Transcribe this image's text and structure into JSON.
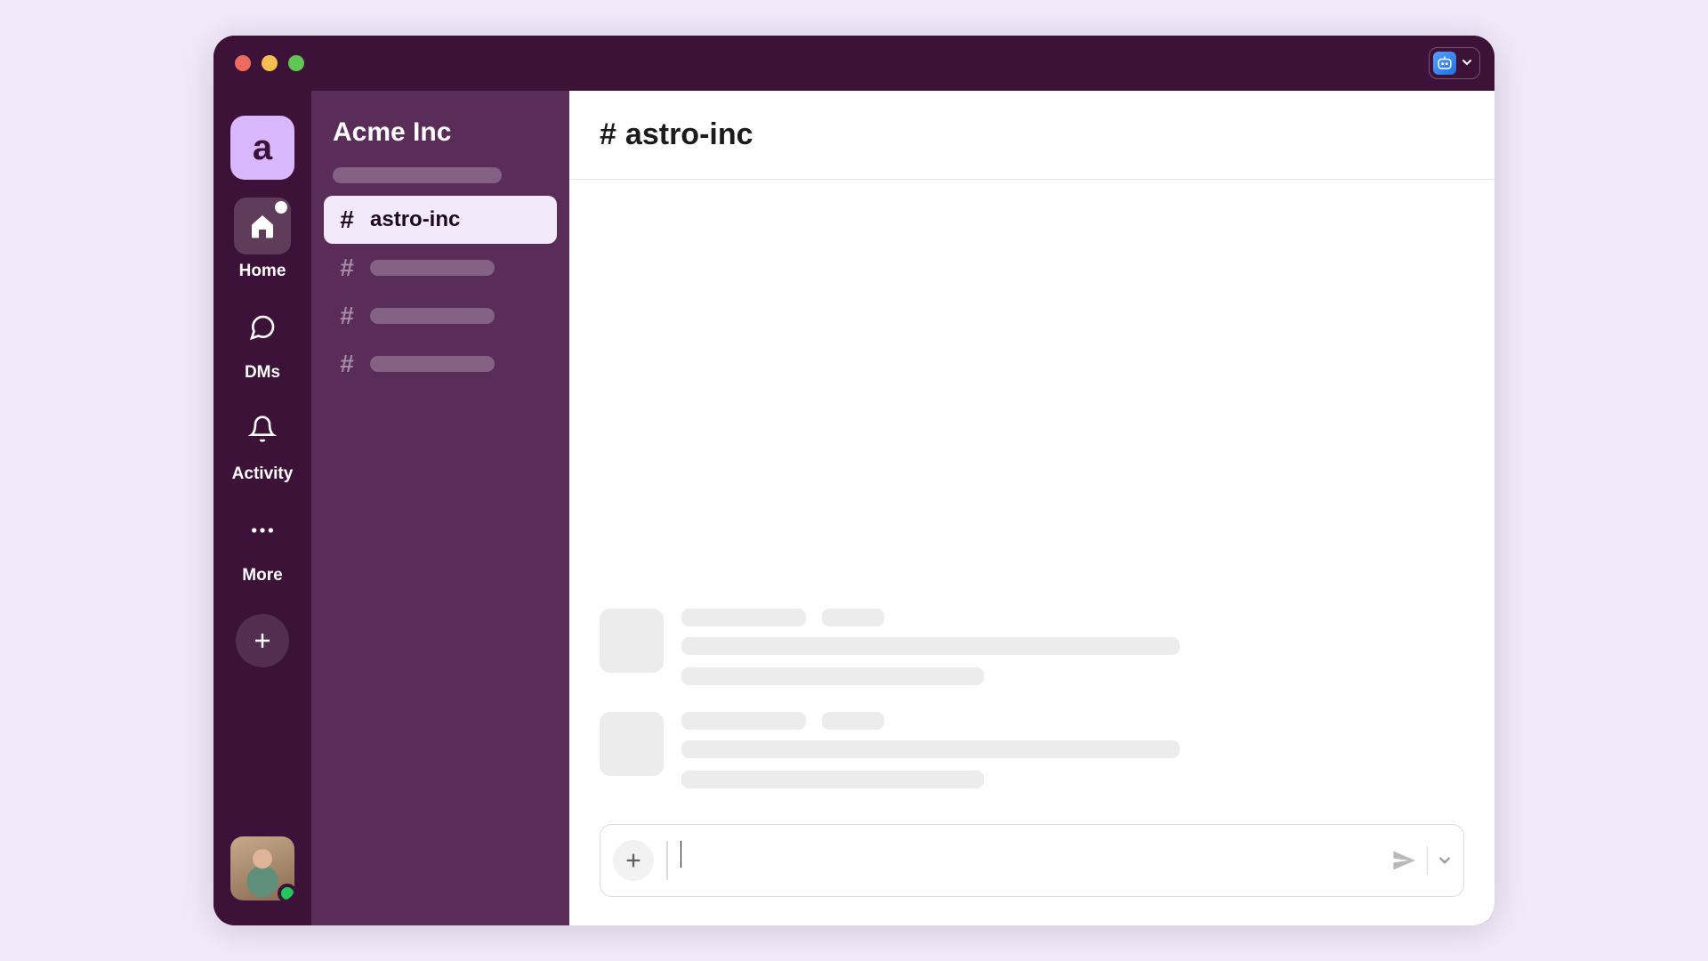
{
  "workspace": {
    "initial": "a",
    "name": "Acme Inc"
  },
  "rail": {
    "home": "Home",
    "dms": "DMs",
    "activity": "Activity",
    "more": "More"
  },
  "channels": {
    "selected": "astro-inc"
  },
  "header": {
    "channel": "astro-inc"
  },
  "composer": {
    "placeholder": ""
  }
}
